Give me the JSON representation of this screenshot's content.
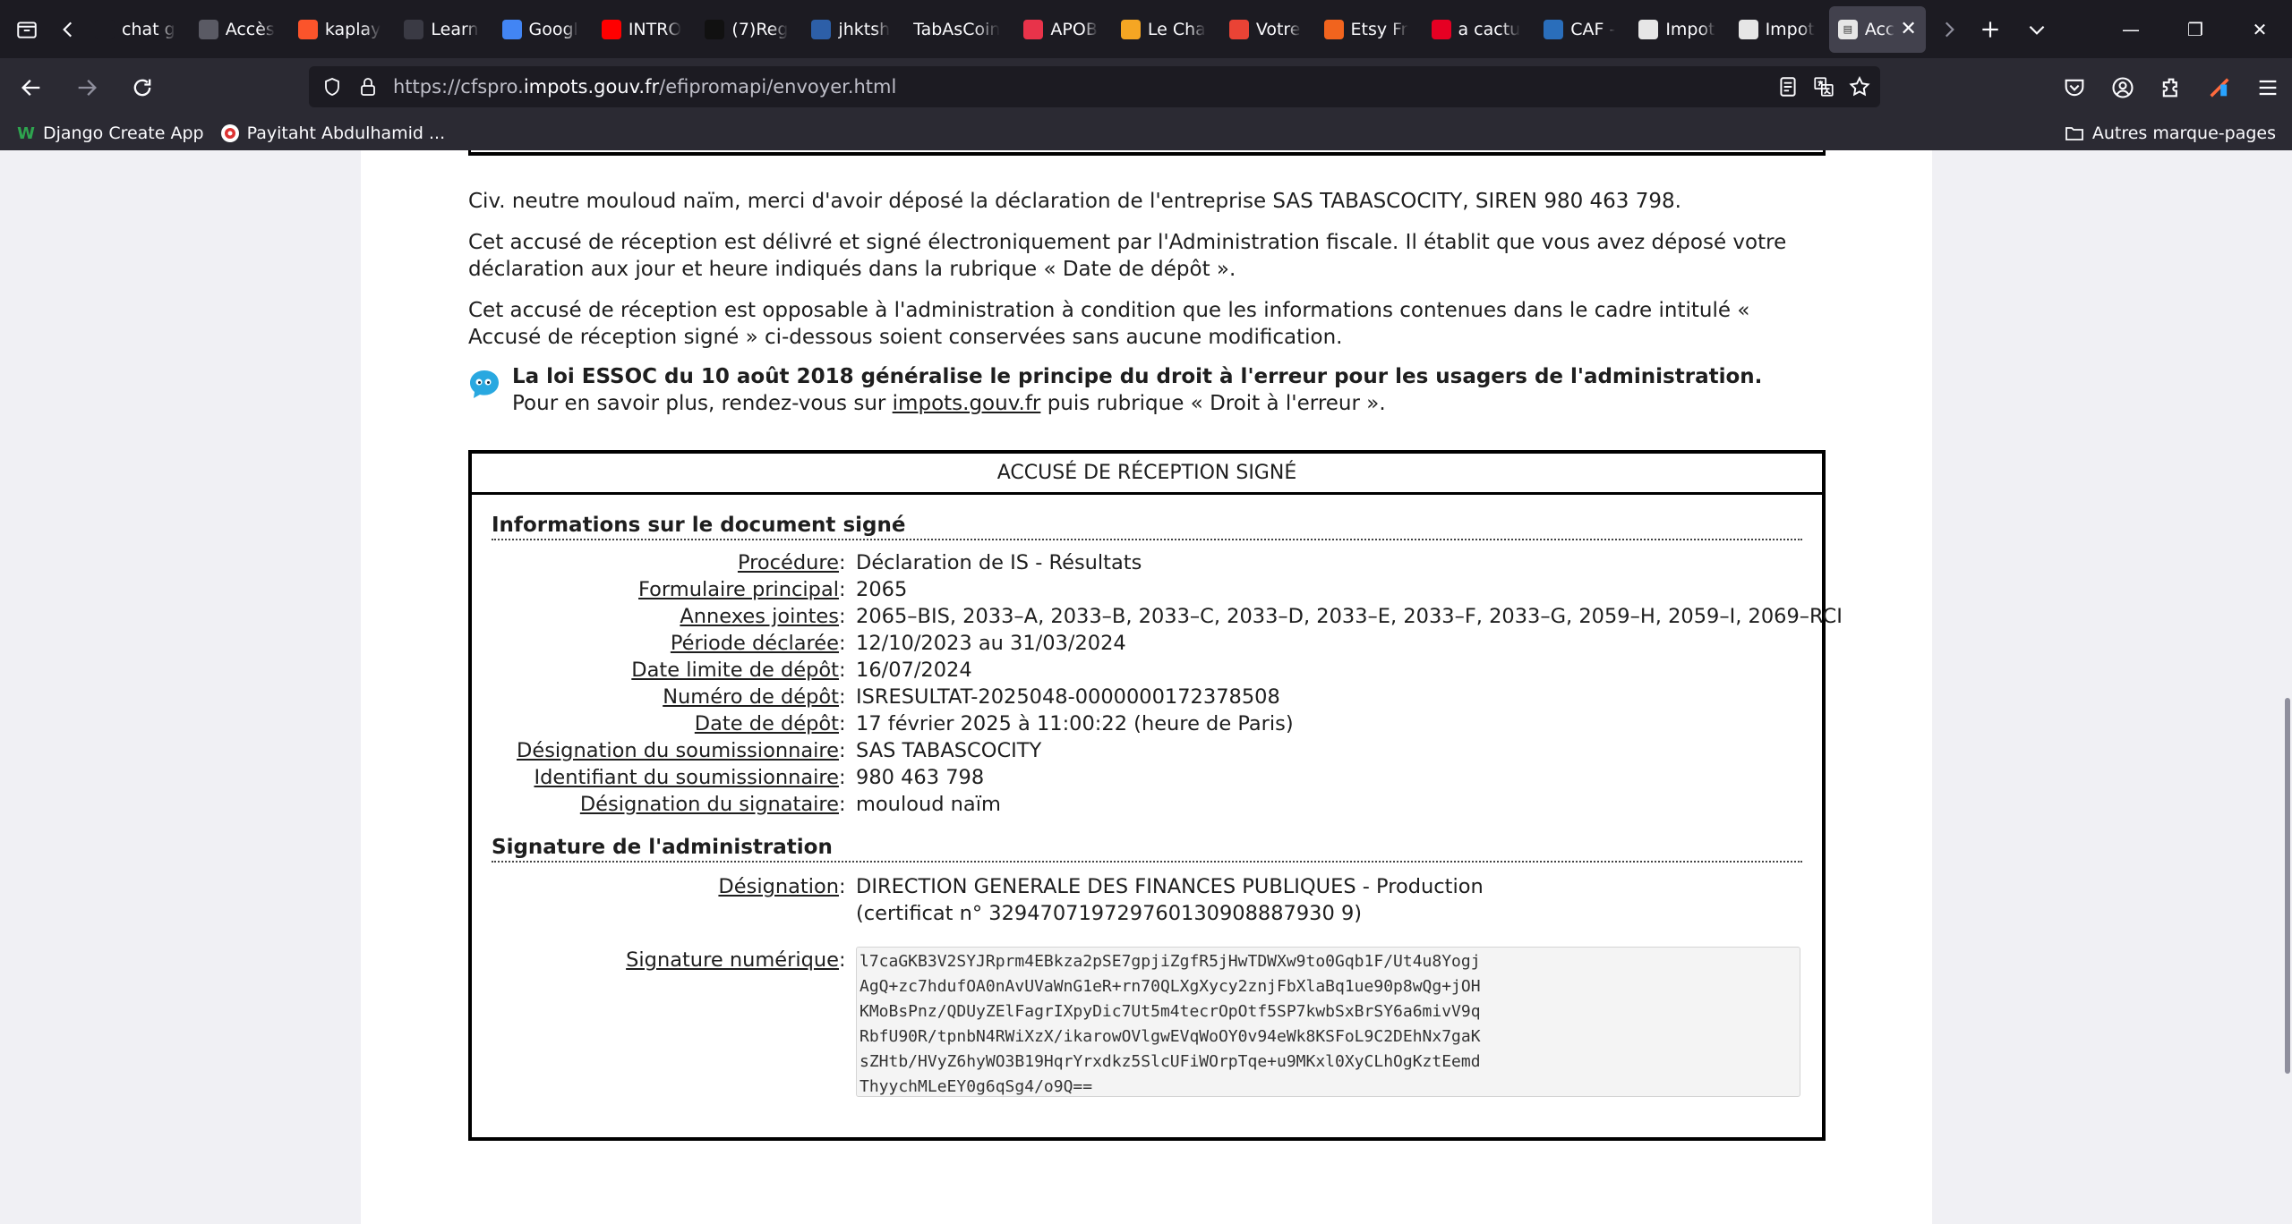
{
  "browser": {
    "tabs": [
      {
        "label": "chat g",
        "icon": "chatgpt-icon",
        "color": "#1c1b22"
      },
      {
        "label": "Accès",
        "icon": "openai-icon",
        "color": "#5a5a64"
      },
      {
        "label": "kaplay",
        "icon": "brave-icon",
        "color": "#fb542b"
      },
      {
        "label": "Learn",
        "icon": "learn-icon",
        "color": "#3a3a44"
      },
      {
        "label": "Googl",
        "icon": "google-translate-icon",
        "color": "#4285f4"
      },
      {
        "label": "INTRO",
        "icon": "youtube-icon",
        "color": "#ff0000"
      },
      {
        "label": "(7)Reg",
        "icon": "tiktok-icon",
        "color": "#111111"
      },
      {
        "label": "jhktsh",
        "icon": "app-icon",
        "color": "#2d5fa8"
      },
      {
        "label": "TabAsCoin",
        "icon": "",
        "color": ""
      },
      {
        "label": "APOB",
        "icon": "apob-icon",
        "color": "#e8334a"
      },
      {
        "label": "Le Cha",
        "icon": "m-logo-icon",
        "color": "#f5a623"
      },
      {
        "label": "Votre",
        "icon": "gmail-icon",
        "color": "#ea4335"
      },
      {
        "label": "Etsy Fr",
        "icon": "etsy-icon",
        "color": "#f1641e"
      },
      {
        "label": "a cactu",
        "icon": "pinterest-icon",
        "color": "#e60023"
      },
      {
        "label": "CAF -",
        "icon": "caf-icon",
        "color": "#2a6ebb"
      },
      {
        "label": "Impot",
        "icon": "impots-icon",
        "color": "#e6e6e6"
      },
      {
        "label": "Impot",
        "icon": "impots-icon",
        "color": "#e6e6e6"
      }
    ],
    "active_tab": {
      "label": "Acc"
    },
    "url": {
      "prefix": "https://cfspro.",
      "host": "impots.gouv.fr",
      "path": "/efipromapi/envoyer.html"
    },
    "bookmarks": [
      {
        "label": "Django Create App",
        "icon": "w-icon",
        "color": "#2ea44f"
      },
      {
        "label": "Payitaht Abdulhamid ...",
        "icon": "payitaht-icon",
        "color": "#d33"
      }
    ],
    "other_bookmarks": "Autres marque-pages"
  },
  "page": {
    "intro": "Civ. neutre mouloud naïm, merci d'avoir déposé la déclaration de l'entreprise SAS TABASCOCITY, SIREN 980 463 798.",
    "p2": "Cet accusé de réception est délivré et signé électroniquement par l'Administration fiscale. Il établit que vous avez déposé votre déclaration aux jour et heure indiqués dans la rubrique « Date de dépôt ».",
    "p3": "Cet accusé de réception est opposable à l'administration à condition que les informations contenues dans le cadre intitulé « Accusé de réception signé » ci-dessous soient conservées sans aucune modification.",
    "essoc_bold": "La loi ESSOC du 10 août 2018 généralise le principe du droit à l'erreur pour les usagers de l'administration.",
    "essoc_pre": "Pour en savoir plus, rendez-vous sur ",
    "essoc_link": "impots.gouv.fr",
    "essoc_post": " puis rubrique « Droit à l'erreur ».",
    "receipt_title": "ACCUSÉ DE RÉCEPTION SIGNÉ",
    "section1_title": "Informations sur le document signé",
    "doc_rows": [
      {
        "key": "Procédure",
        "value": "Déclaration de IS - Résultats"
      },
      {
        "key": "Formulaire principal",
        "value": "2065"
      },
      {
        "key": "Annexes jointes",
        "value": "2065–BIS, 2033–A, 2033–B, 2033–C, 2033–D, 2033–E, 2033–F, 2033–G, 2059–H, 2059–I, 2069–RCI"
      },
      {
        "key": "Période déclarée",
        "value": "12/10/2023 au 31/03/2024"
      },
      {
        "key": "Date limite de dépôt",
        "value": "16/07/2024"
      },
      {
        "key": "Numéro de dépôt",
        "value": "ISRESULTAT-2025048-0000000172378508"
      },
      {
        "key": "Date de dépôt",
        "value": "17 février 2025 à 11:00:22 (heure de Paris)"
      },
      {
        "key": "Désignation du soumissionnaire",
        "value": "SAS TABASCOCITY"
      },
      {
        "key": "Identifiant du soumissionnaire",
        "value": "980 463 798"
      },
      {
        "key": "Désignation du signataire",
        "value": "mouloud naïm"
      }
    ],
    "section2_title": "Signature de l'administration",
    "designation_key": "Désignation",
    "designation_value": "DIRECTION GENERALE DES FINANCES PUBLIQUES - Production",
    "certificate": "(certificat n° 329470719729760130908887930 9)",
    "signature_key": "Signature numérique",
    "signature_lines": [
      "l7caGKB3V2SYJRprm4EBkza2pSE7gpjiZgfR5jHwTDWXw9to0Gqb1F/Ut4u8Yogj",
      "AgQ+zc7hdufOA0nAvUVaWnG1eR+rn70QLXgXycy2znjFbXlaBq1ue90p8wQg+jOH",
      "KMoBsPnz/QDUyZElFagrIXpyDic7Ut5m4tecrOpOtf5SP7kwbSxBrSY6a6mivV9q",
      "RbfU90R/tpnbN4RWiXzX/ikarowOVlgwEVqWoOY0v94eWk8KSFoL9C2DEhNx7gaK",
      "sZHtb/HVyZ6hyWO3B19HqrYrxdkz5SlcUFiWOrpTqe+u9MKxl0XyCLhOgKztEemd",
      "ThyychMLeEY0g6qSg4/o9Q=="
    ]
  }
}
